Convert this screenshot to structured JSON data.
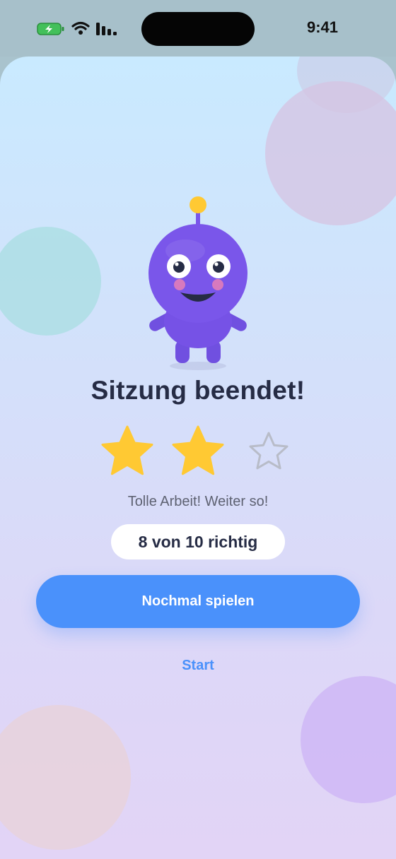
{
  "status_bar": {
    "time": "9:41",
    "icons": [
      "battery-charging-icon",
      "wifi-icon",
      "cellular-signal-icon"
    ]
  },
  "result": {
    "title": "Sitzung beendet!",
    "stars_earned": 2,
    "stars_total": 3,
    "message": "Tolle Arbeit! Weiter so!",
    "score": "8 von 10 richtig"
  },
  "actions": {
    "play_again_label": "Nochmal spielen",
    "start_label": "Start"
  },
  "colors": {
    "accent": "#4a91fb",
    "star_filled": "#ffc933",
    "star_empty": "#b8bcc8",
    "mascot": "#7a56ea",
    "title": "#262c45"
  }
}
